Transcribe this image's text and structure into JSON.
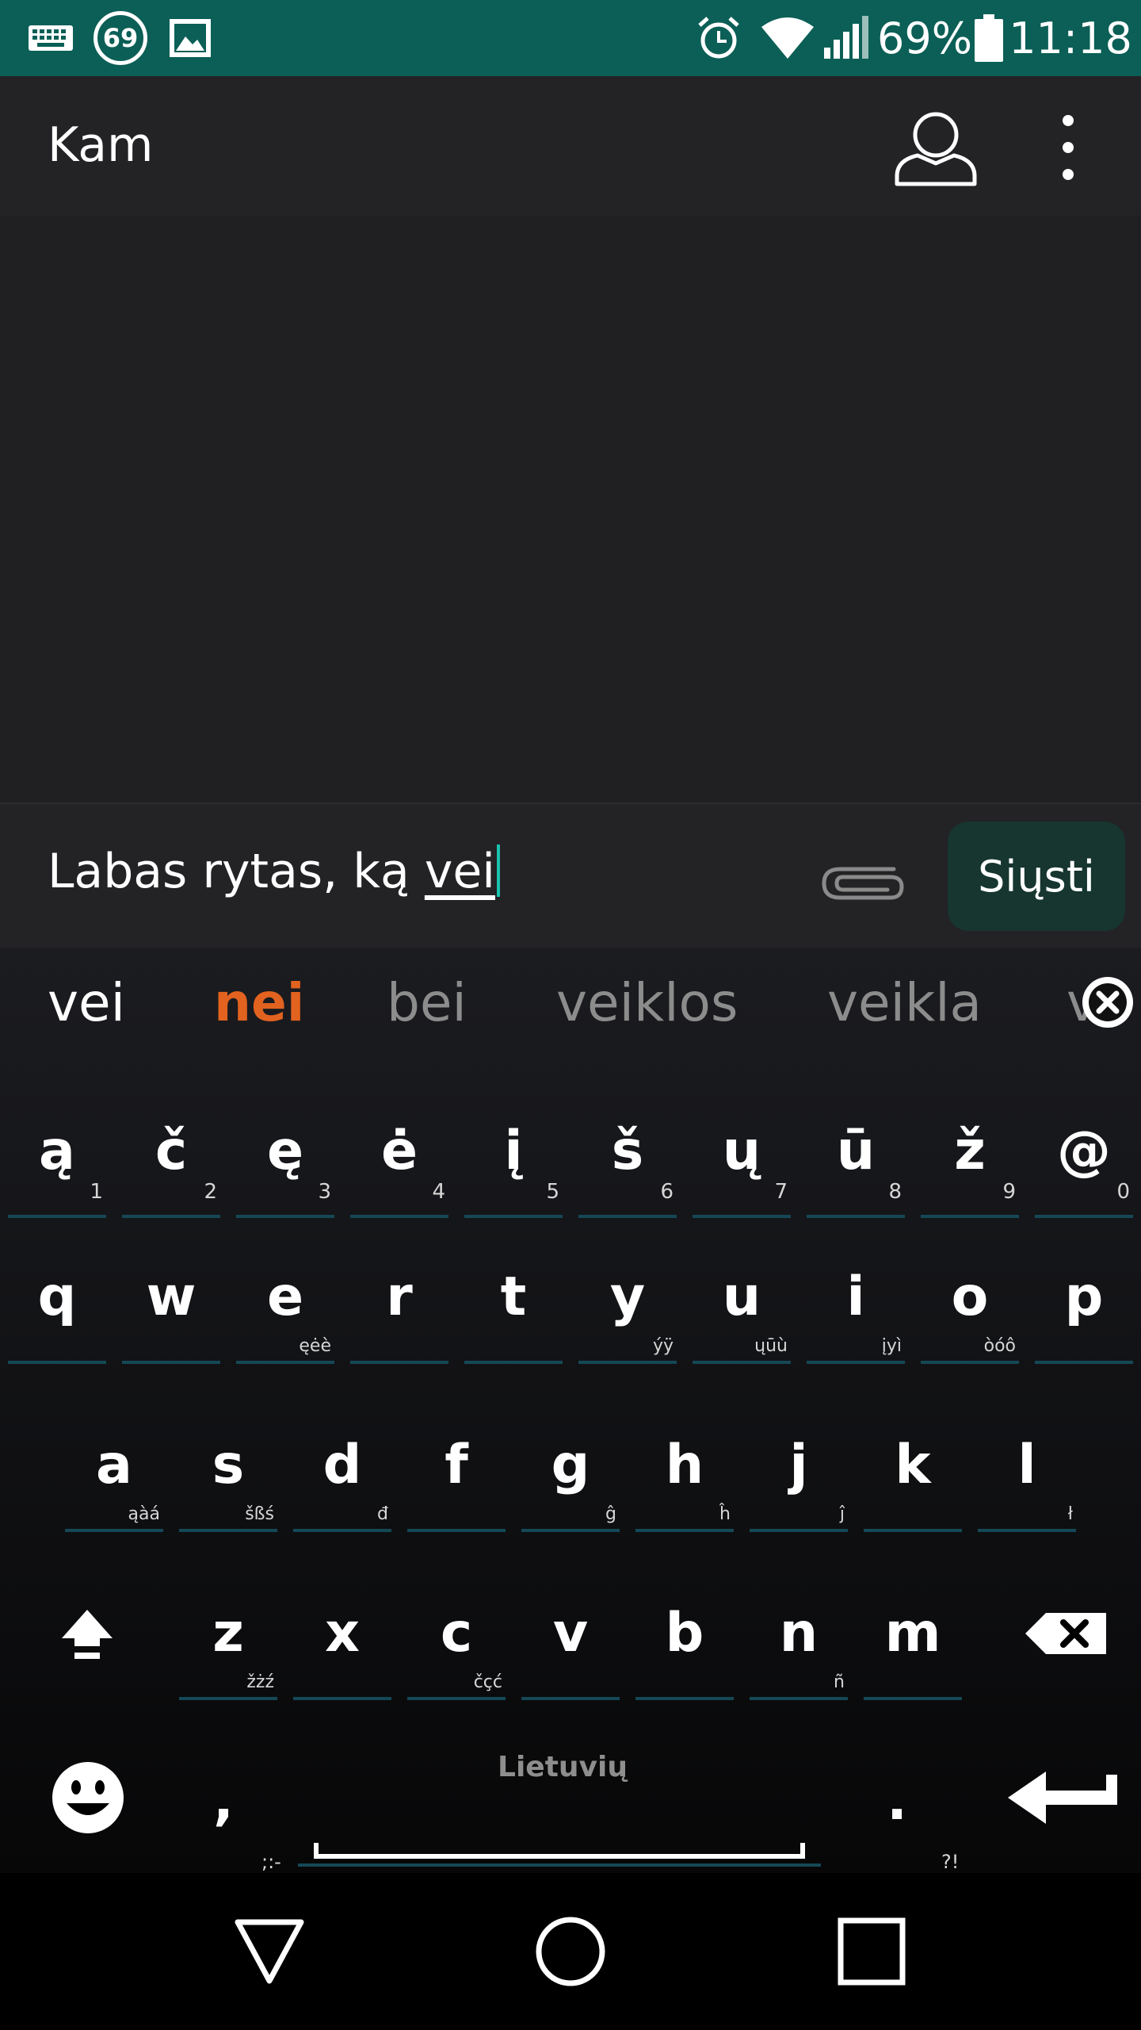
{
  "status_bar": {
    "notification_count": "69",
    "battery_percent": "69%",
    "time": "11:18",
    "background_color": "#0b5f56",
    "icons": [
      "keyboard-icon",
      "notification-badge-icon",
      "image-icon",
      "alarm-icon",
      "wifi-icon",
      "signal-icon",
      "battery-icon"
    ]
  },
  "app_bar": {
    "title": "Kam",
    "icons": [
      "contact-icon",
      "more-options-icon"
    ]
  },
  "compose": {
    "committed_text": "Labas rytas, ką ",
    "composing_text": "vei",
    "send_label": "Siųsti",
    "attach_icon": "paperclip-icon"
  },
  "keyboard": {
    "suggestions": [
      {
        "text": "vei",
        "style": "typed"
      },
      {
        "text": "nei",
        "style": "best",
        "color": "#e2621f"
      },
      {
        "text": "bei",
        "style": "normal"
      },
      {
        "text": "veiklos",
        "style": "normal"
      },
      {
        "text": "veikla",
        "style": "normal"
      },
      {
        "text": "v",
        "style": "normal"
      }
    ],
    "rows": [
      [
        {
          "main": "ą",
          "sub": "1"
        },
        {
          "main": "č",
          "sub": "2"
        },
        {
          "main": "ę",
          "sub": "3"
        },
        {
          "main": "ė",
          "sub": "4"
        },
        {
          "main": "į",
          "sub": "5"
        },
        {
          "main": "š",
          "sub": "6"
        },
        {
          "main": "ų",
          "sub": "7"
        },
        {
          "main": "ū",
          "sub": "8"
        },
        {
          "main": "ž",
          "sub": "9"
        },
        {
          "main": "@",
          "sub": "0"
        }
      ],
      [
        {
          "main": "q",
          "sub": ""
        },
        {
          "main": "w",
          "sub": ""
        },
        {
          "main": "e",
          "sub": "ęėè"
        },
        {
          "main": "r",
          "sub": ""
        },
        {
          "main": "t",
          "sub": ""
        },
        {
          "main": "y",
          "sub": "ýÿ"
        },
        {
          "main": "u",
          "sub": "ųūù"
        },
        {
          "main": "i",
          "sub": "įyì"
        },
        {
          "main": "o",
          "sub": "òóô"
        },
        {
          "main": "p",
          "sub": ""
        }
      ],
      [
        {
          "main": "a",
          "sub": "ąàá"
        },
        {
          "main": "s",
          "sub": "šßś"
        },
        {
          "main": "d",
          "sub": "đ"
        },
        {
          "main": "f",
          "sub": ""
        },
        {
          "main": "g",
          "sub": "ĝ"
        },
        {
          "main": "h",
          "sub": "ĥ"
        },
        {
          "main": "j",
          "sub": "ĵ"
        },
        {
          "main": "k",
          "sub": ""
        },
        {
          "main": "l",
          "sub": "ł"
        }
      ],
      [
        {
          "main": "z",
          "sub": "žżź"
        },
        {
          "main": "x",
          "sub": ""
        },
        {
          "main": "c",
          "sub": "čçć"
        },
        {
          "main": "v",
          "sub": ""
        },
        {
          "main": "b",
          "sub": ""
        },
        {
          "main": "n",
          "sub": "ñ"
        },
        {
          "main": "m",
          "sub": ""
        }
      ]
    ],
    "bottom_row": {
      "comma": {
        "main": ",",
        "sub": ";:-"
      },
      "space_label": "Lietuvių",
      "period": {
        "main": ".",
        "sub": "?!"
      }
    },
    "icons": [
      "shift-icon",
      "backspace-icon",
      "emoji-icon",
      "enter-icon",
      "dismiss-suggestions-icon"
    ]
  },
  "nav_bar": {
    "icons": [
      "back-icon",
      "home-icon",
      "recents-icon"
    ]
  }
}
